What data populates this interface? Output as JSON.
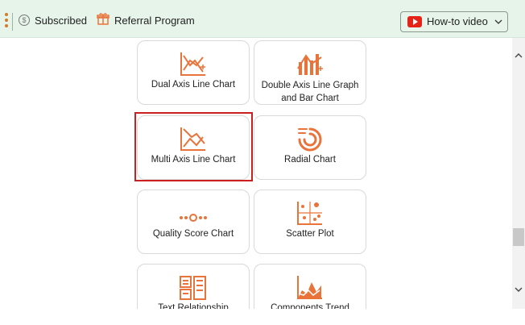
{
  "topbar": {
    "subscribed_label": "Subscribed",
    "referral_label": "Referral Program",
    "howto_label": "How-to video"
  },
  "cards": [
    {
      "label": "Dual Axis Line Chart",
      "icon": "dual-axis-line-chart-icon"
    },
    {
      "label": "Double Axis Line Graph and Bar Chart",
      "icon": "double-axis-bar-line-icon"
    },
    {
      "label": "Multi Axis Line Chart",
      "icon": "multi-axis-line-chart-icon",
      "selected": true
    },
    {
      "label": "Radial Chart",
      "icon": "radial-chart-icon"
    },
    {
      "label": "Quality Score Chart",
      "icon": "quality-score-icon"
    },
    {
      "label": "Scatter Plot",
      "icon": "scatter-plot-icon"
    },
    {
      "label": "Text Relationship",
      "icon": "text-relationship-icon"
    },
    {
      "label": "Components Trend",
      "icon": "components-trend-icon"
    }
  ],
  "colors": {
    "accent": "#e8743b",
    "selection": "#cc1f1f",
    "topbar_bg": "#e6f4ea"
  }
}
